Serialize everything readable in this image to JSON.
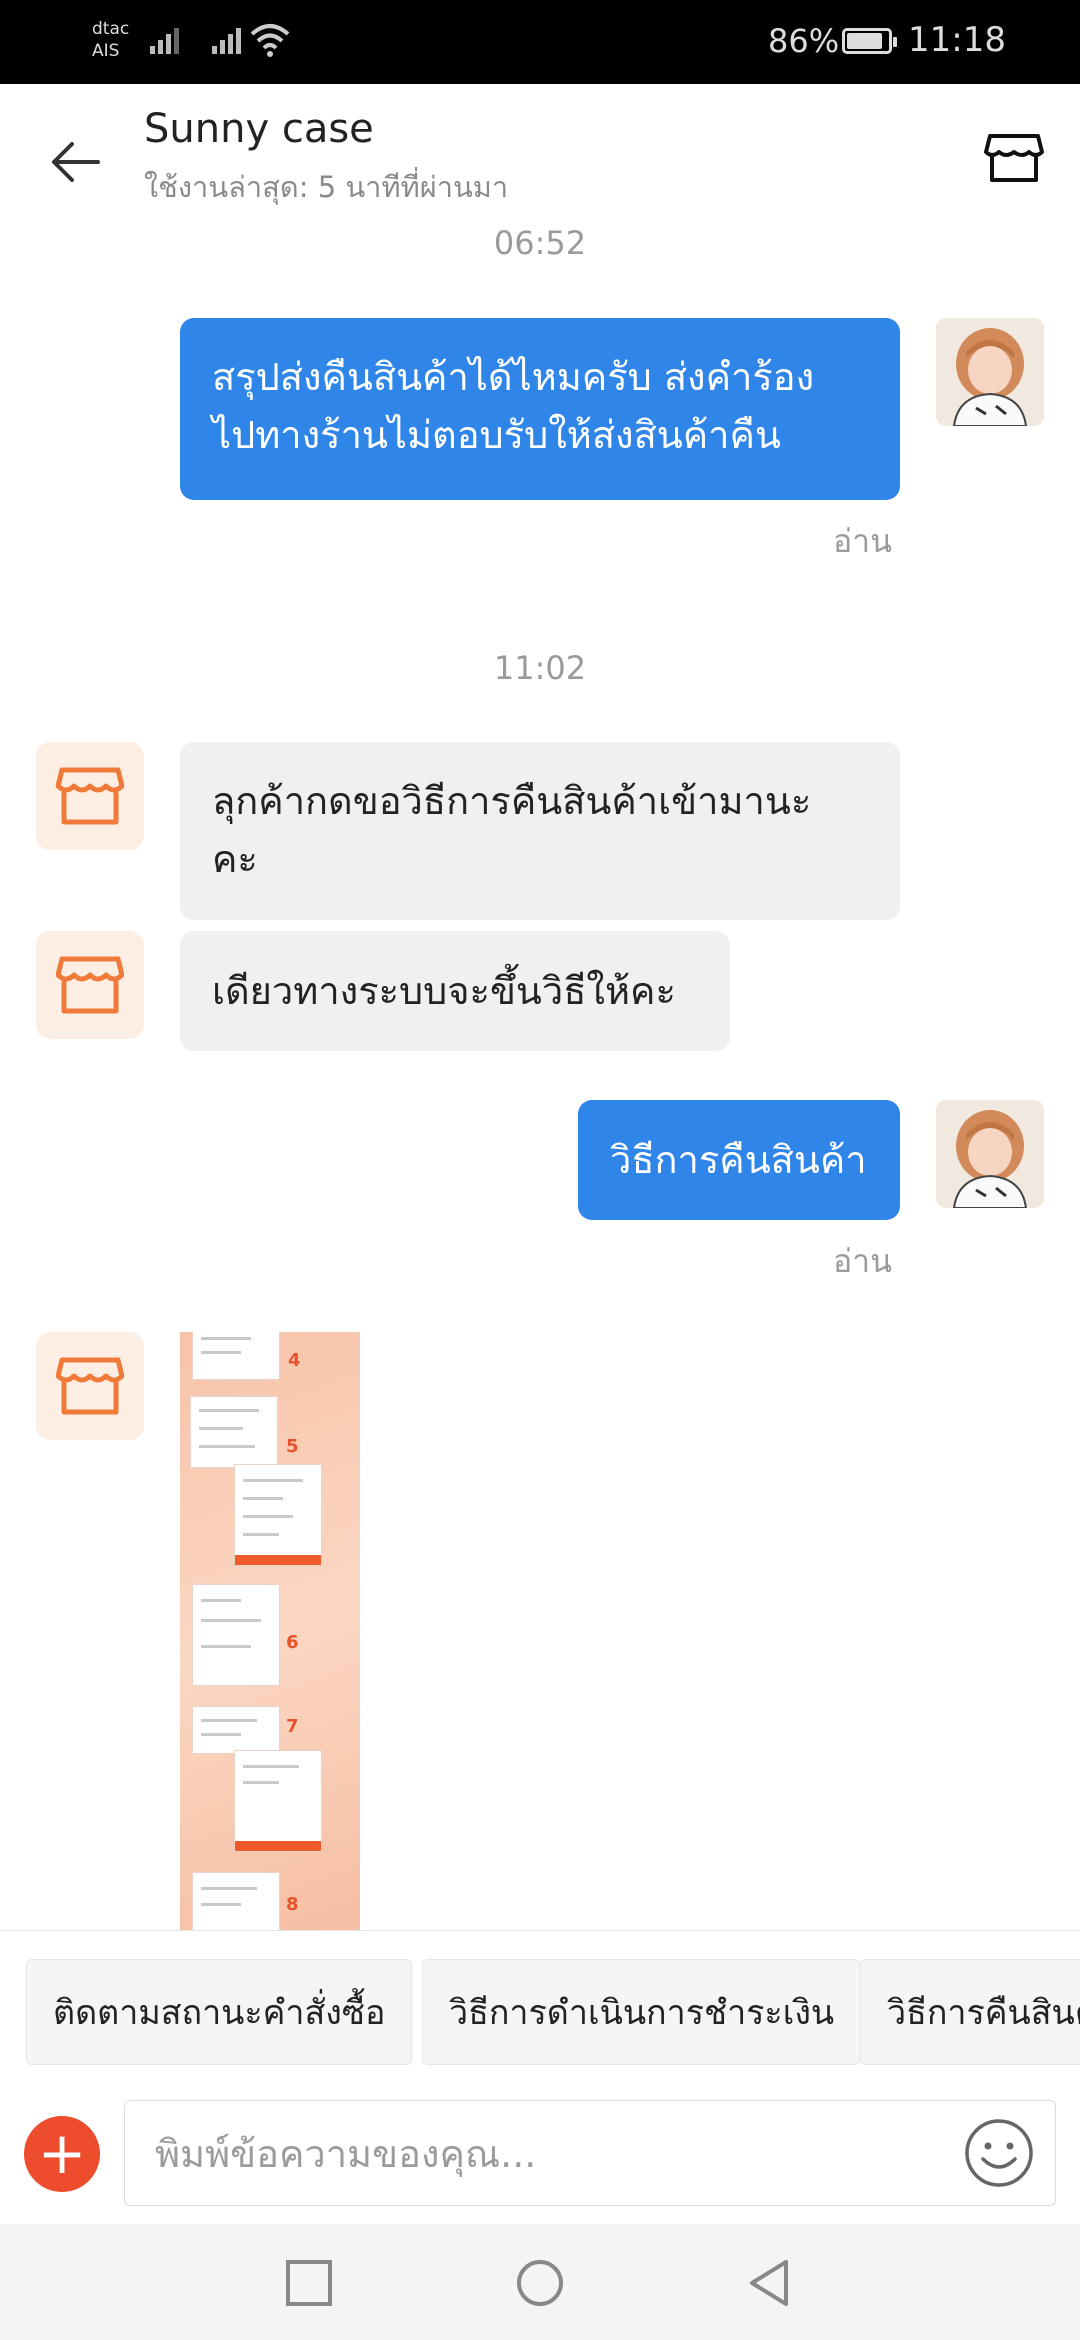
{
  "status_bar": {
    "carrier_top": "dtac",
    "carrier_bottom": "AIS",
    "battery": "86%",
    "time": "11:18"
  },
  "header": {
    "title": "Sunny case",
    "subtitle": "ใช้งานล่าสุด: 5 นาทีที่ผ่านมา"
  },
  "chat": {
    "timestamp_1": "06:52",
    "msg_1_line_1": "สรุปส่งคืนสินค้าได้ไหมครับ ส่งคำร้อง",
    "msg_1_line_2": "ไปทางร้านไม่ตอบรับให้ส่งสินค้าคืน",
    "read_1": "อ่าน",
    "timestamp_2": "11:02",
    "msg_2_line_1": "ลุกค้ากดขอวิธีการคืนสินค้าเข้ามานะ",
    "msg_2_line_2": "คะ",
    "msg_3": "เดียวทางระบบจะขึ้นวิธีให้คะ",
    "msg_4": "วิธีการคืนสินค้า",
    "read_2": "อ่าน"
  },
  "quick_replies": [
    "ติดตามสถานะคำสั่งซื้อ",
    "วิธีการดำเนินการชำระเงิน",
    "วิธีการคืนสินค้า"
  ],
  "input": {
    "placeholder": "พิมพ์ข้อความของคุณ..."
  },
  "colors": {
    "my_bubble": "#2f86e8",
    "their_bubble": "#f0f0f0",
    "accent": "#ee4d2d",
    "shop_icon": "#f07a3a"
  },
  "icons": {
    "back": "back-arrow-icon",
    "store": "store-icon",
    "add": "plus-icon",
    "emoji": "smiley-icon",
    "nav_recent": "square-icon",
    "nav_home": "circle-icon",
    "nav_back": "triangle-back-icon"
  }
}
